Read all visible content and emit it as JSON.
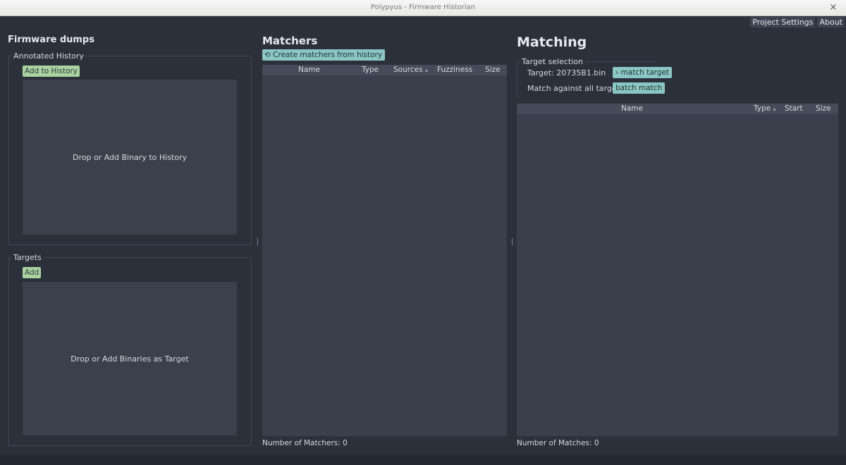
{
  "window": {
    "title": "Polypyus - Firmware Historian",
    "close_glyph": "×"
  },
  "menu": {
    "project_settings": "Project Settings",
    "about": "About"
  },
  "firmware": {
    "heading": "Firmware dumps",
    "history": {
      "label": "Annotated History",
      "add_button": "Add to History",
      "drop_text": "Drop or Add Binary to History"
    },
    "targets": {
      "label": "Targets",
      "add_button": "Add",
      "drop_text": "Drop or Add Binaries as Target"
    }
  },
  "matchers": {
    "heading": "Matchers",
    "create_button": "Create matchers from history",
    "columns": {
      "name": "Name",
      "type": "Type",
      "sources": "Sources",
      "fuzziness": "Fuzziness",
      "size": "Size"
    },
    "status": "Number of Matchers: 0"
  },
  "matching": {
    "heading": "Matching",
    "target_selection": {
      "label": "Target selection",
      "target_text": "Target: 20735B1.bin",
      "match_target_button": "match target",
      "all_targets_text": "Match against all targets",
      "batch_match_button": "batch match"
    },
    "columns": {
      "name": "Name",
      "type": "Type",
      "start": "Start",
      "size": "Size"
    },
    "status": "Number of Matches: 0"
  },
  "icons": {
    "sort_indicator": "▴",
    "play": "›",
    "refresh": "⟲"
  }
}
